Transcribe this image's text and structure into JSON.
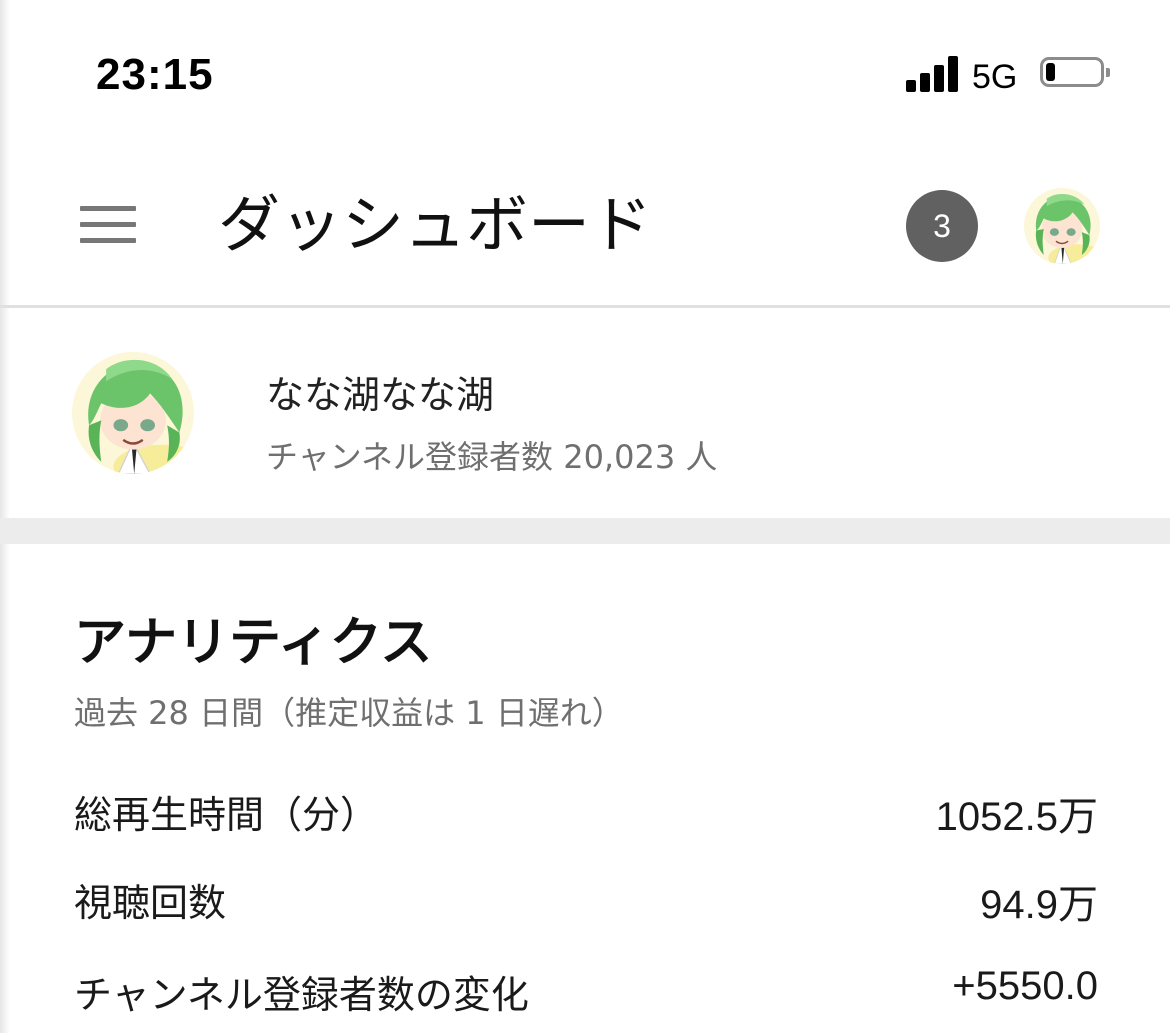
{
  "status_bar": {
    "time": "23:15",
    "network": "5G",
    "signal_bars": 4,
    "battery_level": 0.18
  },
  "app_bar": {
    "title": "ダッシュボード",
    "notification_count": "3",
    "icons": [
      "menu-icon",
      "avatar"
    ]
  },
  "channel": {
    "name": "なな湖なな湖",
    "subscribers": "チャンネル登録者数 20,023 人"
  },
  "analytics": {
    "title": "アナリティクス",
    "subtitle": "過去 28 日間（推定収益は 1 日遅れ）",
    "metrics": [
      {
        "label": "総再生時間（分）",
        "value": "1052.5万"
      },
      {
        "label": "視聴回数",
        "value": "94.9万"
      },
      {
        "label": "チャンネル登録者数の変化",
        "value": "+5550.0"
      }
    ]
  },
  "colors": {
    "badge": "#616161",
    "avatar_hair": "#6cc46a",
    "secondary_text": "#6f6f6f",
    "divider": "#e0e0e0"
  }
}
